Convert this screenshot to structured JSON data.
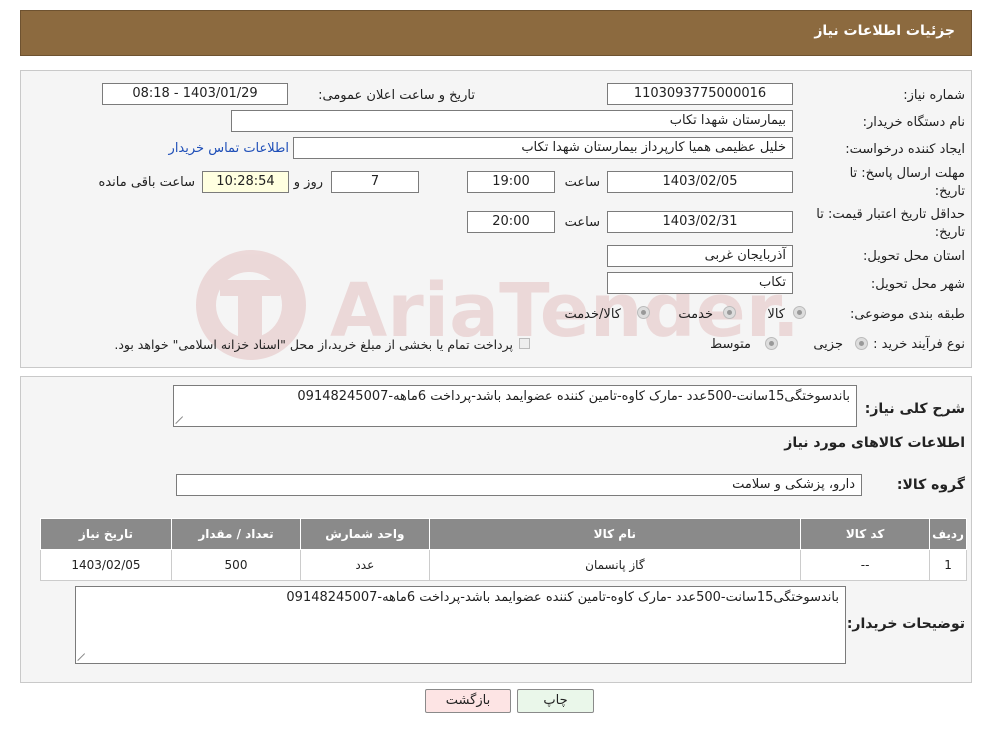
{
  "header": {
    "title": "جزئیات اطلاعات نیاز"
  },
  "form": {
    "need_number_label": "شماره نیاز:",
    "need_number": "1103093775000016",
    "announce_label": "تاریخ و ساعت اعلان عمومی:",
    "announce_value": "1403/01/29 - 08:18",
    "buyer_org_label": "نام دستگاه خریدار:",
    "buyer_org": "بیمارستان شهدا تکاب",
    "creator_label": "ایجاد کننده درخواست:",
    "creator": "خلیل عظیمی همیا کارپرداز بیمارستان شهدا تکاب",
    "contact_link": "اطلاعات تماس خریدار",
    "reply_deadline_label_1": "مهلت ارسال پاسخ: تا",
    "reply_deadline_label_2": "تاریخ:",
    "reply_date": "1403/02/05",
    "time_label": "ساعت",
    "reply_time": "19:00",
    "days": "7",
    "days_label": "روز و",
    "remaining": "10:28:54",
    "remaining_label": "ساعت باقی مانده",
    "validity_label_1": "حداقل تاریخ اعتبار قیمت: تا",
    "validity_label_2": "تاریخ:",
    "validity_date": "1403/02/31",
    "validity_time": "20:00",
    "province_label": "استان محل تحویل:",
    "province": "آذربایجان غربی",
    "city_label": "شهر محل تحویل:",
    "city": "تکاب",
    "category_label": "طبقه بندی موضوعی:",
    "category_options": [
      "کالا",
      "خدمت",
      "کالا/خدمت"
    ],
    "purchase_label": "نوع فرآیند خرید :",
    "purchase_options": [
      "جزیی",
      "متوسط"
    ],
    "purchase_note": "پرداخت تمام یا بخشی از مبلغ خرید،از محل \"اسناد خزانه اسلامی\" خواهد بود."
  },
  "details": {
    "summary_label": "شرح کلی نیاز:",
    "summary": "باندسوختگی15سانت-500عدد -مارک کاوه-تامین کننده عضوایمد باشد-پرداخت 6ماهه-09148245007",
    "items_title": "اطلاعات کالاهای مورد نیاز",
    "group_label": "گروه کالا:",
    "group": "دارو، پزشکی و سلامت",
    "table": {
      "headers": [
        "ردیف",
        "کد کالا",
        "نام کالا",
        "واحد شمارش",
        "تعداد / مقدار",
        "تاریخ نیاز"
      ],
      "rows": [
        [
          "1",
          "--",
          "گاز پانسمان",
          "عدد",
          "500",
          "1403/02/05"
        ]
      ]
    },
    "buyer_notes_label": "توضیحات خریدار:",
    "buyer_notes": "باندسوختگی15سانت-500عدد -مارک کاوه-تامین کننده عضوایمد باشد-پرداخت 6ماهه-09148245007"
  },
  "buttons": {
    "print": "چاپ",
    "back": "بازگشت"
  },
  "watermark": "AriaTender.neT",
  "colors": {
    "header": "#8c6a3f",
    "table_header": "#8a8a8a",
    "link": "#1f4fb8",
    "back_button": "#fde4e4",
    "print_button": "#eaf7ea"
  }
}
